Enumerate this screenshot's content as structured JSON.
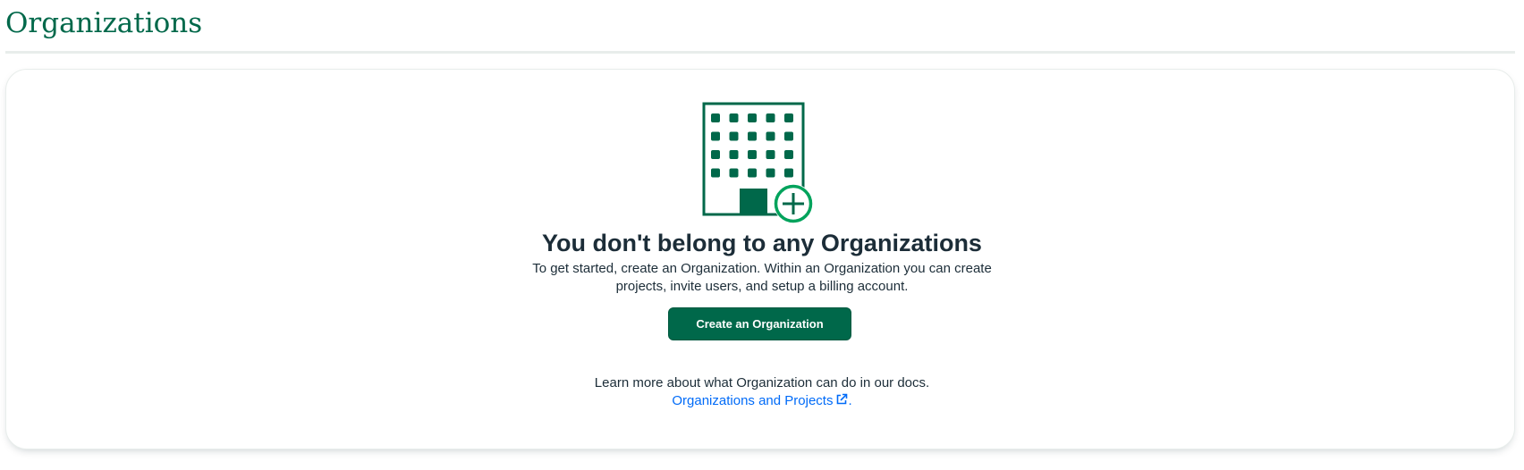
{
  "header": {
    "title": "Organizations"
  },
  "empty_state": {
    "illustration_icon": "building-add-icon",
    "heading": "You don't belong to any Organizations",
    "description_line1": "To get started, create an Organization. Within an Organization you can create",
    "description_line2": "projects, invite users, and setup a billing account.",
    "create_button_label": "Create an Organization",
    "docs_note": "Learn more about what Organization can do in our docs.",
    "docs_link_label": "Organizations and Projects",
    "docs_link_icon": "external-link-icon",
    "docs_link_suffix": "."
  },
  "colors": {
    "brand_green": "#00684a",
    "accent_green": "#00a35c",
    "link_blue": "#016bf8",
    "text_dark": "#1c2d38"
  }
}
